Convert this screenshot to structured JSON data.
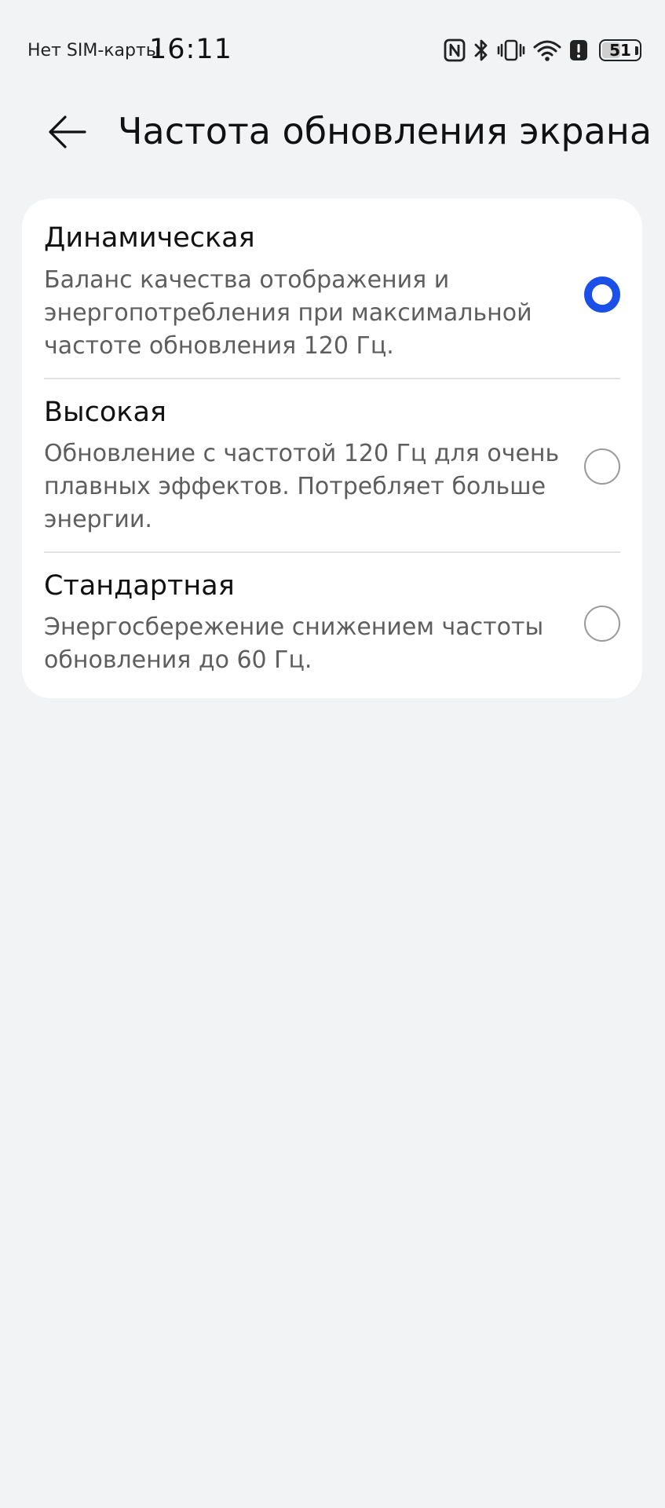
{
  "status_bar": {
    "sim_text": "Нет SIM-карты",
    "time": "16:11",
    "battery_level": "51",
    "battery_fraction": 0.51,
    "icons": [
      "nfc-icon",
      "bluetooth-icon",
      "vibrate-icon",
      "wifi-icon",
      "alert-icon",
      "battery-icon"
    ]
  },
  "header": {
    "back_icon": "arrow-left-icon",
    "title": "Частота обновления экрана"
  },
  "accent_color": "#1a4fe8",
  "options": [
    {
      "title": "Динамическая",
      "description": "Баланс качества отображения и энергопотребления при максимальной частоте обновления 120 Гц.",
      "selected": true
    },
    {
      "title": "Высокая",
      "description": "Обновление с частотой 120 Гц для очень плавных эффектов. Потребляет больше энергии.",
      "selected": false
    },
    {
      "title": "Стандартная",
      "description": "Энергосбережение снижением частоты обновления до 60 Гц.",
      "selected": false
    }
  ]
}
